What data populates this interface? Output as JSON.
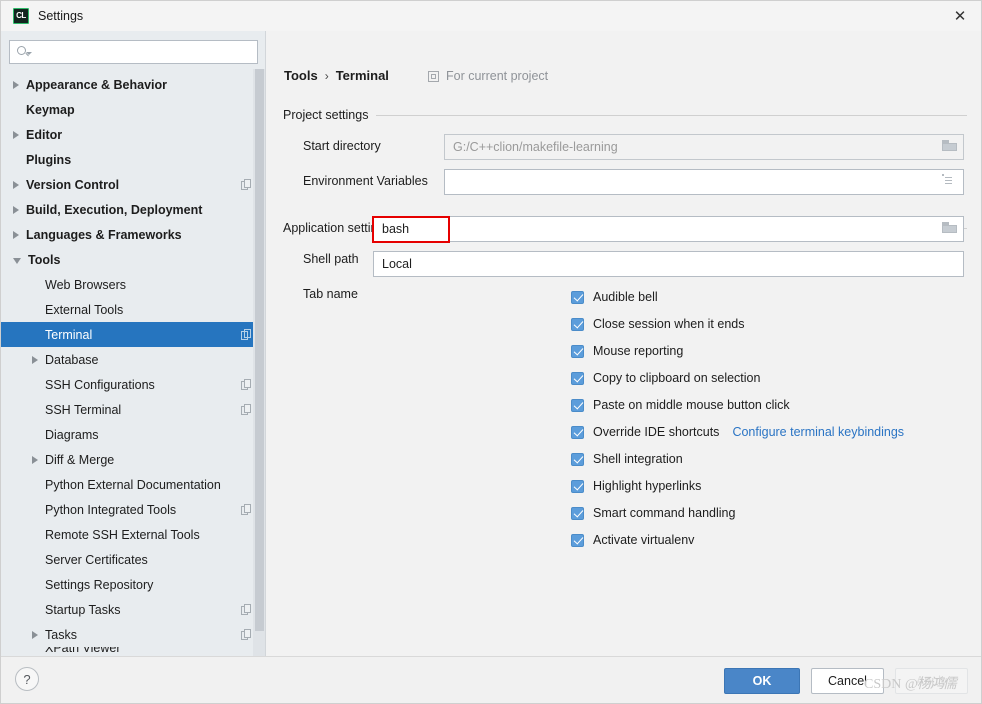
{
  "window": {
    "title": "Settings",
    "logo_text": "CL",
    "logo_icon": "clion-logo-icon",
    "close_icon": "✕"
  },
  "sidebar": {
    "search": {
      "value": "",
      "placeholder": "",
      "icon": "search-icon"
    },
    "items": [
      {
        "label": "Appearance & Behavior",
        "level": 0,
        "arrow": "right",
        "badge": false
      },
      {
        "label": "Keymap",
        "level": 0,
        "arrow": "none",
        "badge": false
      },
      {
        "label": "Editor",
        "level": 0,
        "arrow": "right",
        "badge": false
      },
      {
        "label": "Plugins",
        "level": 0,
        "arrow": "none",
        "badge": false
      },
      {
        "label": "Version Control",
        "level": 0,
        "arrow": "right",
        "badge": true
      },
      {
        "label": "Build, Execution, Deployment",
        "level": 0,
        "arrow": "right",
        "badge": false
      },
      {
        "label": "Languages & Frameworks",
        "level": 0,
        "arrow": "right",
        "badge": false
      },
      {
        "label": "Tools",
        "level": 0,
        "arrow": "down",
        "badge": false
      },
      {
        "label": "Web Browsers",
        "level": 1,
        "arrow": "none",
        "badge": false
      },
      {
        "label": "External Tools",
        "level": 1,
        "arrow": "none",
        "badge": false
      },
      {
        "label": "Terminal",
        "level": 1,
        "arrow": "none",
        "badge": true,
        "selected": true
      },
      {
        "label": "Database",
        "level": 1,
        "arrow": "right",
        "badge": false
      },
      {
        "label": "SSH Configurations",
        "level": 1,
        "arrow": "none",
        "badge": true
      },
      {
        "label": "SSH Terminal",
        "level": 1,
        "arrow": "none",
        "badge": true
      },
      {
        "label": "Diagrams",
        "level": 1,
        "arrow": "none",
        "badge": false
      },
      {
        "label": "Diff & Merge",
        "level": 1,
        "arrow": "right",
        "badge": false
      },
      {
        "label": "Python External Documentation",
        "level": 1,
        "arrow": "none",
        "badge": false
      },
      {
        "label": "Python Integrated Tools",
        "level": 1,
        "arrow": "none",
        "badge": true
      },
      {
        "label": "Remote SSH External Tools",
        "level": 1,
        "arrow": "none",
        "badge": false
      },
      {
        "label": "Server Certificates",
        "level": 1,
        "arrow": "none",
        "badge": false
      },
      {
        "label": "Settings Repository",
        "level": 1,
        "arrow": "none",
        "badge": false
      },
      {
        "label": "Startup Tasks",
        "level": 1,
        "arrow": "none",
        "badge": true
      },
      {
        "label": "Tasks",
        "level": 1,
        "arrow": "right",
        "badge": true
      },
      {
        "label": "XPath Viewer",
        "level": 1,
        "arrow": "none",
        "badge": false,
        "clipped": true
      }
    ]
  },
  "main": {
    "breadcrumb": {
      "parent": "Tools",
      "separator": "›",
      "current": "Terminal"
    },
    "for_current_project": {
      "label": "For current project",
      "icon": "copy-scope-icon"
    },
    "groups": {
      "project_settings": "Project settings",
      "application_settings": "Application settings"
    },
    "fields": {
      "start_directory": {
        "label": "Start directory",
        "value": "G:/C++clion/makefile-learning",
        "icon": "folder-browse-icon",
        "disabled": true
      },
      "environment_variables": {
        "label": "Environment Variables",
        "value": "",
        "icon": "env-list-icon"
      },
      "shell_path": {
        "label": "Shell path",
        "value": "bash",
        "icon": "folder-browse-icon",
        "highlighted": true,
        "highlight_color": "#e60000"
      },
      "tab_name": {
        "label": "Tab name",
        "value": "Local"
      }
    },
    "checkboxes": [
      {
        "label": "Audible bell",
        "checked": true
      },
      {
        "label": "Close session when it ends",
        "checked": true
      },
      {
        "label": "Mouse reporting",
        "checked": true
      },
      {
        "label": "Copy to clipboard on selection",
        "checked": true
      },
      {
        "label": "Paste on middle mouse button click",
        "checked": true
      },
      {
        "label": "Override IDE shortcuts",
        "checked": true,
        "link": "Configure terminal keybindings"
      },
      {
        "label": "Shell integration",
        "checked": true
      },
      {
        "label": "Highlight hyperlinks",
        "checked": true
      },
      {
        "label": "Smart command handling",
        "checked": true
      },
      {
        "label": "Activate virtualenv",
        "checked": true
      }
    ]
  },
  "footer": {
    "help_label": "?",
    "ok_label": "OK",
    "cancel_label": "Cancel",
    "apply_label": "Apply"
  },
  "watermark": {
    "site": "CSDN",
    "author": "@杨鸿儒"
  },
  "colors": {
    "accent_selection": "#2675bf",
    "checkbox": "#5c9ddb",
    "link": "#2a74c4",
    "primary_button": "#4a86c8",
    "highlight": "#e60000"
  }
}
